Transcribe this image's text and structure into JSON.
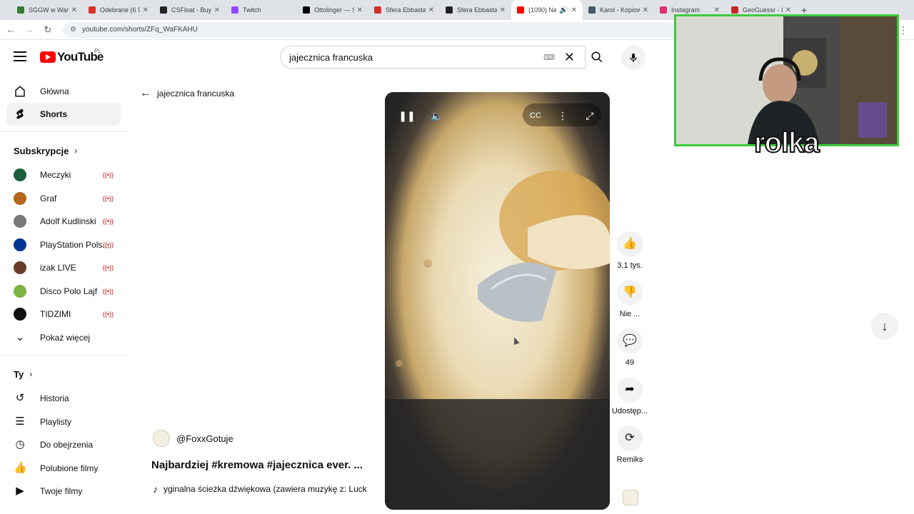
{
  "browser": {
    "tabs": [
      {
        "label": "SGGW w Warszaw",
        "color": "#2e7d32"
      },
      {
        "label": "Odebrane (6 933)",
        "color": "#d93025"
      },
      {
        "label": "CSFloat - Buy &",
        "color": "#222222"
      },
      {
        "label": "Twitch",
        "color": "#9146ff"
      },
      {
        "label": "Ottolinger — Su",
        "color": "#000000"
      },
      {
        "label": "Sfera Ebbasta - R",
        "color": "#d32f2f"
      },
      {
        "label": "Sfera Ebbasta: R",
        "color": "#222222"
      },
      {
        "label": "(1090) Najba",
        "color": "#ff0000"
      },
      {
        "label": "Karol - Kopiowa",
        "color": "#455a64"
      },
      {
        "label": "Instagram",
        "color": "#e1306c"
      },
      {
        "label": "GeoGuessr - Let",
        "color": "#c62828"
      }
    ],
    "url": "youtube.com/shorts/ZFq_WaFKAHU"
  },
  "header": {
    "logo_text": "YouTube",
    "country": "PL",
    "search_value": "jajecznica francuska"
  },
  "sidebar": {
    "main": [
      {
        "label": "Główna",
        "icon": "home-icon"
      },
      {
        "label": "Shorts",
        "icon": "shorts-icon"
      }
    ],
    "subs_title": "Subskrypcje",
    "subs": [
      {
        "label": "Meczyki",
        "color": "#1b5e3b"
      },
      {
        "label": "Graf",
        "color": "#b5651d"
      },
      {
        "label": "Adolf Kudlinski",
        "color": "#777777"
      },
      {
        "label": "PlayStation Pols...",
        "color": "#003791"
      },
      {
        "label": "izak LIVE",
        "color": "#6b3b2a"
      },
      {
        "label": "Disco Polo Lajf",
        "color": "#7cb342"
      },
      {
        "label": "TIDZIMI",
        "color": "#111111"
      }
    ],
    "show_more": "Pokaż więcej",
    "you_title": "Ty",
    "you": [
      {
        "label": "Historia",
        "icon": "history-icon"
      },
      {
        "label": "Playlisty",
        "icon": "playlist-icon"
      },
      {
        "label": "Do obejrzenia",
        "icon": "watch-later-icon"
      },
      {
        "label": "Polubione filmy",
        "icon": "like-icon"
      },
      {
        "label": "Twoje filmy",
        "icon": "video-icon"
      }
    ]
  },
  "short": {
    "back_label": "jajecznica francuska",
    "channel": "@FoxxGotuje",
    "title": "Najbardziej #kremowa #jajecznica ever. ...",
    "audio": "yginalna ścieżka dźwiękowa (zawiera muzykę z: Luck"
  },
  "actions": [
    {
      "label": "3,1 tys.",
      "icon": "thumbs-up-icon"
    },
    {
      "label": "Nie ...",
      "icon": "thumbs-down-icon"
    },
    {
      "label": "49",
      "icon": "comment-icon"
    },
    {
      "label": "Udostęp...",
      "icon": "share-icon"
    },
    {
      "label": "Remiks",
      "icon": "remix-icon"
    }
  ],
  "overlay_text": "rolka"
}
